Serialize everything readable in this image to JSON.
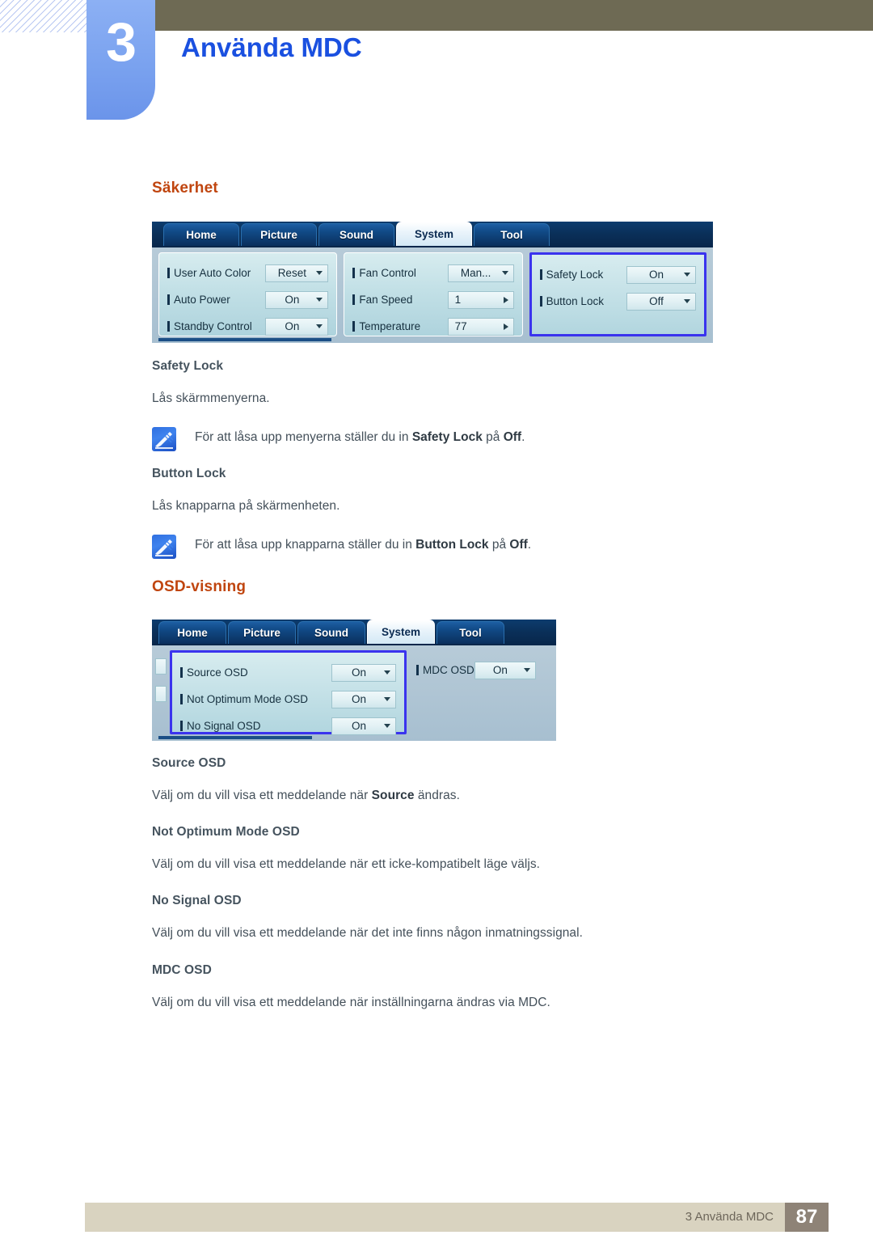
{
  "header": {
    "chapter_number": "3",
    "chapter_title": "Använda MDC"
  },
  "sections": [
    {
      "heading": "Säkerhet",
      "subsections": [
        {
          "title": "Safety Lock",
          "body": "Lås skärmmenyerna."
        },
        {
          "title": "Button Lock",
          "body": "Lås knapparna på skärmenheten."
        }
      ],
      "notes": [
        {
          "icon": "note-pen-icon",
          "prefix": "För att låsa upp menyerna ställer du in ",
          "bold1": "Safety Lock",
          "mid": " på ",
          "bold2": "Off",
          "suffix": "."
        },
        {
          "icon": "note-pen-icon",
          "prefix": "För att låsa upp knapparna ställer du in ",
          "bold1": "Button Lock",
          "mid": " på ",
          "bold2": "Off",
          "suffix": "."
        }
      ]
    },
    {
      "heading": "OSD-visning",
      "subsections": [
        {
          "title": "Source OSD",
          "body_prefix": "Välj om du vill visa ett meddelande när ",
          "body_bold": "Source",
          "body_suffix": " ändras."
        },
        {
          "title": "Not Optimum Mode OSD",
          "body": "Välj om du vill visa ett meddelande när ett icke-kompatibelt läge väljs."
        },
        {
          "title": "No Signal OSD",
          "body": "Välj om du vill visa ett meddelande när det inte finns någon inmatningssignal."
        },
        {
          "title": "MDC OSD",
          "body": "Välj om du vill visa ett meddelande när inställningarna ändras via MDC."
        }
      ]
    }
  ],
  "mdc_system_panel": {
    "tabs": [
      {
        "label": "Home",
        "active": false
      },
      {
        "label": "Picture",
        "active": false
      },
      {
        "label": "Sound",
        "active": false
      },
      {
        "label": "System",
        "active": true
      },
      {
        "label": "Tool",
        "active": false
      }
    ],
    "groups": [
      {
        "focused": false,
        "rows": [
          {
            "label": "User Auto Color",
            "value": "Reset",
            "control": "dropdown"
          },
          {
            "label": "Auto Power",
            "value": "On",
            "control": "dropdown"
          },
          {
            "label": "Standby Control",
            "value": "On",
            "control": "dropdown"
          }
        ]
      },
      {
        "focused": false,
        "rows": [
          {
            "label": "Fan Control",
            "value": "Man...",
            "control": "dropdown"
          },
          {
            "label": "Fan Speed",
            "value": "1",
            "control": "spinner"
          },
          {
            "label": "Temperature",
            "value": "77",
            "control": "spinner"
          }
        ]
      },
      {
        "focused": true,
        "rows": [
          {
            "label": "Safety Lock",
            "value": "On",
            "control": "dropdown"
          },
          {
            "label": "Button Lock",
            "value": "Off",
            "control": "dropdown"
          }
        ]
      }
    ]
  },
  "mdc_osd_panel": {
    "tabs": [
      {
        "label": "Home",
        "active": false
      },
      {
        "label": "Picture",
        "active": false
      },
      {
        "label": "Sound",
        "active": false
      },
      {
        "label": "System",
        "active": true
      },
      {
        "label": "Tool",
        "active": false
      }
    ],
    "groups": [
      {
        "focused": true,
        "rows": [
          {
            "label": "Source OSD",
            "value": "On",
            "control": "dropdown"
          },
          {
            "label": "Not Optimum Mode OSD",
            "value": "On",
            "control": "dropdown"
          },
          {
            "label": "No Signal OSD",
            "value": "On",
            "control": "dropdown"
          }
        ]
      },
      {
        "focused": false,
        "rows": [
          {
            "label": "MDC OSD",
            "value": "On",
            "control": "dropdown"
          }
        ]
      }
    ]
  },
  "footer": {
    "text": "3 Använda MDC",
    "page": "87"
  },
  "colors": {
    "accent_heading": "#c0450f",
    "chapter_blue": "#1a50e0",
    "olive": "#6e6a54",
    "footer_bar": "#d9d3c0",
    "footer_page": "#8e8377",
    "focus_border": "#3a33ee"
  }
}
